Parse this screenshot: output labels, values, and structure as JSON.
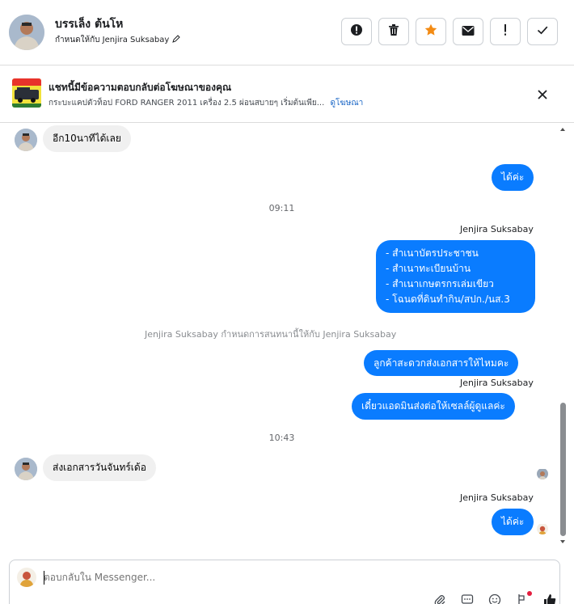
{
  "header": {
    "contact_name": "บรรเล็ง ต้นโห",
    "assigned_text": "กำหนดให้กับ Jenjira Suksabay",
    "actions": [
      {
        "icon": "alert-circle-icon",
        "label": "spam"
      },
      {
        "icon": "trash-icon",
        "label": "delete"
      },
      {
        "icon": "star-icon",
        "label": "star"
      },
      {
        "icon": "mail-icon",
        "label": "unread"
      },
      {
        "icon": "exclamation-icon",
        "label": "follow-up"
      },
      {
        "icon": "check-icon",
        "label": "done"
      }
    ],
    "star_color": "#f38b14"
  },
  "ad": {
    "title": "แชทนี้มีข้อความตอบกลับต่อโฆษณาของคุณ",
    "description": "กระบะแคปตัวท็อป FORD RANGER 2011 เครื่อง 2.5 ผ่อนสบายๆ เริ่มต้นเพีย...",
    "link": "ดูโฆษณา"
  },
  "messages": {
    "m1": "อีก10นาทีได้เลย",
    "m2": "ได้ค่ะ",
    "t1": "09:11",
    "sender1": "Jenjira Suksabay",
    "m3_lines": [
      "- สำเนาบัตรประชาชน",
      "- สำเนาทะเบียนบ้าน",
      "- สำเนาเกษตรกรเล่มเขียว",
      "- โฉนดที่ดินทำกิน/สปก./นส.3"
    ],
    "sys1": "Jenjira Suksabay กำหนดการสนทนานี้ให้กับ Jenjira Suksabay",
    "m4": "ลูกค้าสะดวกส่งเอกสารให้ไหมคะ",
    "sender2": "Jenjira Suksabay",
    "m5": "เดี๋ยวแอดมินส่งต่อให้เซลล์ผู้ดูแลค่ะ",
    "t2": "10:43",
    "m6": "ส่งเอกสารวันจันทร์เด้อ",
    "sender3": "Jenjira Suksabay",
    "m7": "ได้ค่ะ"
  },
  "composer": {
    "placeholder": "ตอบกลับใน Messenger...",
    "tools": [
      "paperclip-icon",
      "chat-template-icon",
      "emoji-icon",
      "tag-icon",
      "thumbs-up-icon"
    ]
  },
  "colors": {
    "outgoing_bubble": "#0a7cff",
    "incoming_bubble": "#f0f0f0",
    "link": "#1a66c6"
  }
}
